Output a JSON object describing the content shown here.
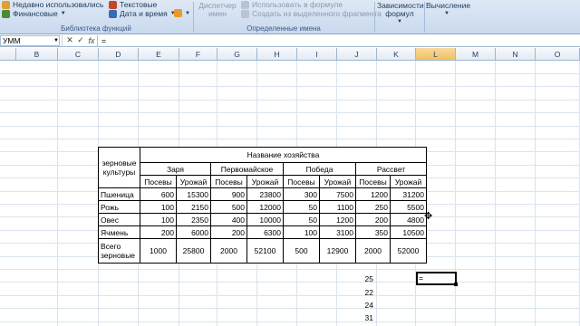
{
  "ribbon": {
    "recent": "Недавно использовались",
    "financial": "Финансовые",
    "text": "Текстовые",
    "datetime": "Дата и время",
    "library_caption": "Библиотека функций",
    "name_manager": "Диспетчер имен",
    "use_in_formula": "Использовать в формуле",
    "create_from_selection": "Создать из выделенного фрагмента",
    "names_caption": "Определенные имена",
    "formula_dependencies": "Зависимости формул",
    "calculation": "Вычисление"
  },
  "formula_bar": {
    "name_box": "УММ",
    "cancel": "✕",
    "enter": "✓",
    "fx": "fx",
    "content": "="
  },
  "columns": [
    "B",
    "C",
    "D",
    "E",
    "F",
    "G",
    "H",
    "I",
    "J",
    "K",
    "L",
    "M",
    "N",
    "O"
  ],
  "table": {
    "crop_label": "зерновые культуры",
    "owner_header": "Название хозяйства",
    "farms": [
      "Заря",
      "Первомайское",
      "Победа",
      "Рассвет"
    ],
    "sub_headers": [
      "Посевы",
      "Урожай"
    ],
    "rows": [
      {
        "name": "Пшеница",
        "values": [
          "600",
          "15300",
          "900",
          "23800",
          "300",
          "7500",
          "1200",
          "31200"
        ]
      },
      {
        "name": "Рожь",
        "values": [
          "100",
          "2150",
          "500",
          "12000",
          "50",
          "1100",
          "250",
          "5500"
        ]
      },
      {
        "name": "Овес",
        "values": [
          "100",
          "2350",
          "400",
          "10000",
          "50",
          "1200",
          "200",
          "4800"
        ]
      },
      {
        "name": "Ячмень",
        "values": [
          "200",
          "6000",
          "200",
          "6300",
          "100",
          "3100",
          "350",
          "10500"
        ]
      }
    ],
    "total_label": "Всего зерновые",
    "totals": [
      "1000",
      "25800",
      "2000",
      "52100",
      "500",
      "12900",
      "2000",
      "52000"
    ]
  },
  "extra_values": [
    "25",
    "22",
    "24",
    "31"
  ],
  "active_cell_content": "="
}
